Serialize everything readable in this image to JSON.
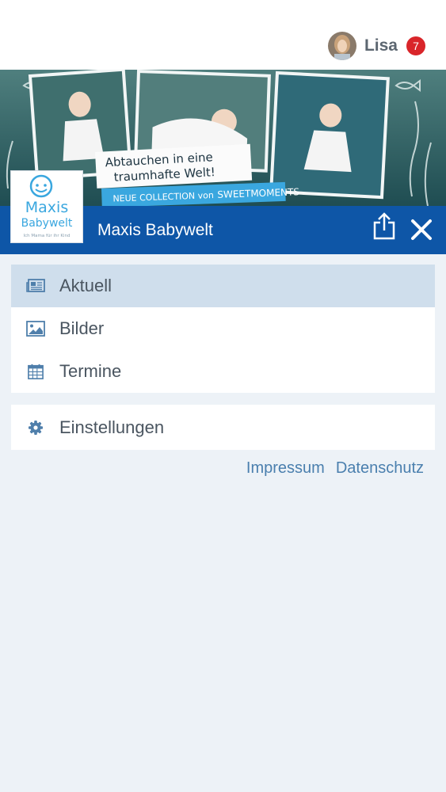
{
  "header": {
    "user_name": "Lisa",
    "notification_count": "7"
  },
  "banner": {
    "headline_line1": "Abtauchen in eine",
    "headline_line2": "traumhafte Welt!",
    "collection_text": "NEUE COLLECTION von",
    "brand_text": "SWEETMOMENTS"
  },
  "logo": {
    "line1": "Maxis",
    "line2": "Babywelt",
    "tagline": "Ich Mama für ihr Kind"
  },
  "titlebar": {
    "title": "Maxis Babywelt"
  },
  "menu": {
    "items": [
      {
        "label": "Aktuell",
        "icon": "newspaper-icon",
        "active": true
      },
      {
        "label": "Bilder",
        "icon": "image-icon",
        "active": false
      },
      {
        "label": "Termine",
        "icon": "calendar-icon",
        "active": false
      }
    ],
    "settings_label": "Einstellungen"
  },
  "footer": {
    "impressum": "Impressum",
    "datenschutz": "Datenschutz"
  },
  "colors": {
    "primary": "#0e56a7",
    "active_row": "#cfdeec",
    "badge": "#d9252a",
    "link": "#4a7fae",
    "page_bg": "#edf2f7"
  }
}
